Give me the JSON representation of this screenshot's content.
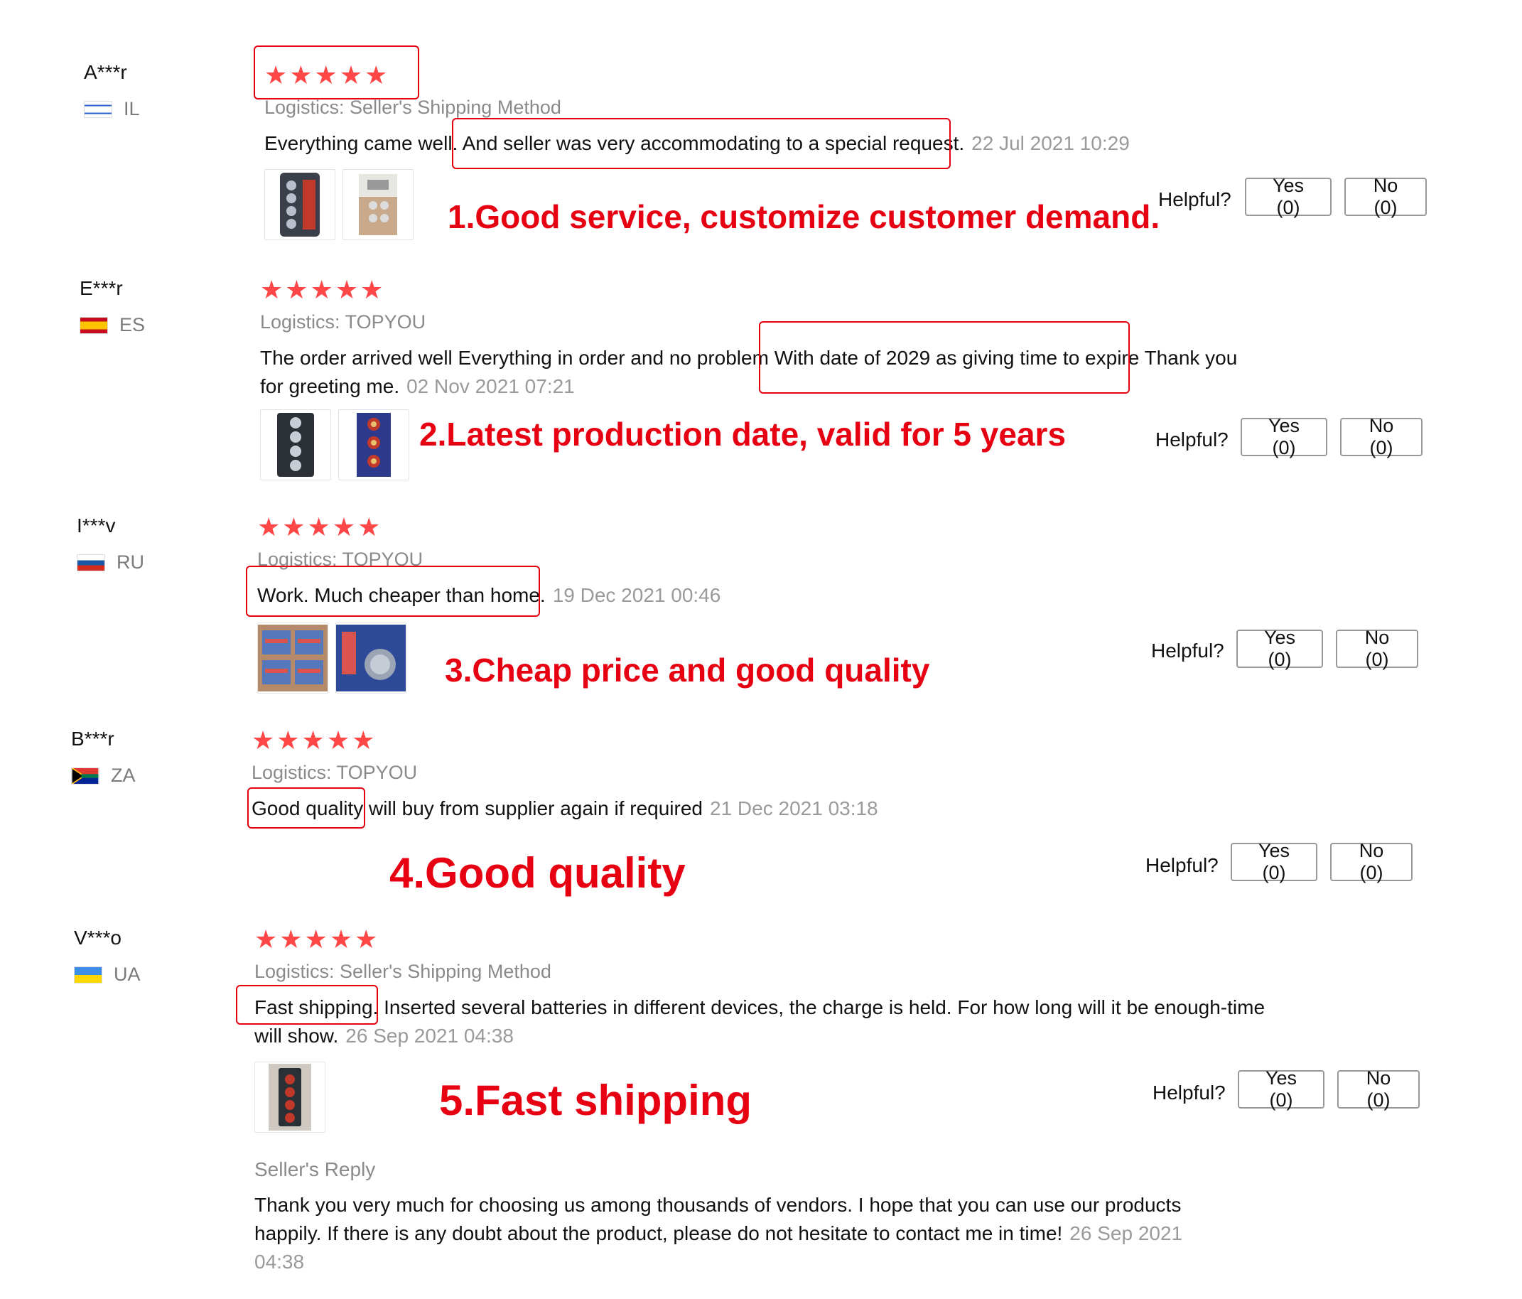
{
  "reviews": [
    {
      "user": "A***r",
      "country": "IL",
      "stars": "★★★★★",
      "logistics": "Logistics: Seller's Shipping Method",
      "text": "Everything came well. And seller was very accommodating to a special request.",
      "date": "22 Jul 2021 10:29",
      "helpful_label": "Helpful?",
      "yes_label": "Yes (0)",
      "no_label": "No (0)",
      "annotation": "1.Good service, customize customer demand."
    },
    {
      "user": "E***r",
      "country": "ES",
      "stars": "★★★★★",
      "logistics": "Logistics: TOPYOU",
      "text": "The order arrived well Everything in order and no problem With date of 2029 as giving time to expire Thank you for greeting me.",
      "date": "02 Nov 2021 07:21",
      "helpful_label": "Helpful?",
      "yes_label": "Yes (0)",
      "no_label": "No (0)",
      "annotation": "2.Latest production date, valid for 5 years"
    },
    {
      "user": "I***v",
      "country": "RU",
      "stars": "★★★★★",
      "logistics": "Logistics: TOPYOU",
      "text": "Work. Much cheaper than home.",
      "date": "19 Dec 2021 00:46",
      "helpful_label": "Helpful?",
      "yes_label": "Yes (0)",
      "no_label": "No (0)",
      "annotation": "3.Cheap price and good quality"
    },
    {
      "user": "B***r",
      "country": "ZA",
      "stars": "★★★★★",
      "logistics": "Logistics: TOPYOU",
      "text": "Good quality will buy from supplier again if required",
      "date": "21 Dec 2021 03:18",
      "helpful_label": "Helpful?",
      "yes_label": "Yes (0)",
      "no_label": "No (0)",
      "annotation": "4.Good quality"
    },
    {
      "user": "V***o",
      "country": "UA",
      "stars": "★★★★★",
      "logistics": "Logistics: Seller's Shipping Method",
      "text": "Fast shipping. Inserted several batteries in different devices, the charge is held. For how long will it be enough-time will show.",
      "date": "26 Sep 2021 04:38",
      "helpful_label": "Helpful?",
      "yes_label": "Yes (0)",
      "no_label": "No (0)",
      "annotation": "5.Fast shipping",
      "seller_reply": {
        "title": "Seller's Reply",
        "text": "Thank you very much for choosing us among thousands of vendors. I hope that you can use our products happily. If there is any doubt about the product, please do not hesitate to contact me in time!",
        "date": "26 Sep 2021 04:38"
      }
    }
  ],
  "colors": {
    "star": "#ff4747",
    "annotation": "#e60012",
    "muted_text": "#8a8a8a"
  },
  "icons": [
    "flag-il-icon",
    "flag-es-icon",
    "flag-ru-icon",
    "flag-za-icon",
    "flag-ua-icon",
    "battery-photo-icon"
  ]
}
